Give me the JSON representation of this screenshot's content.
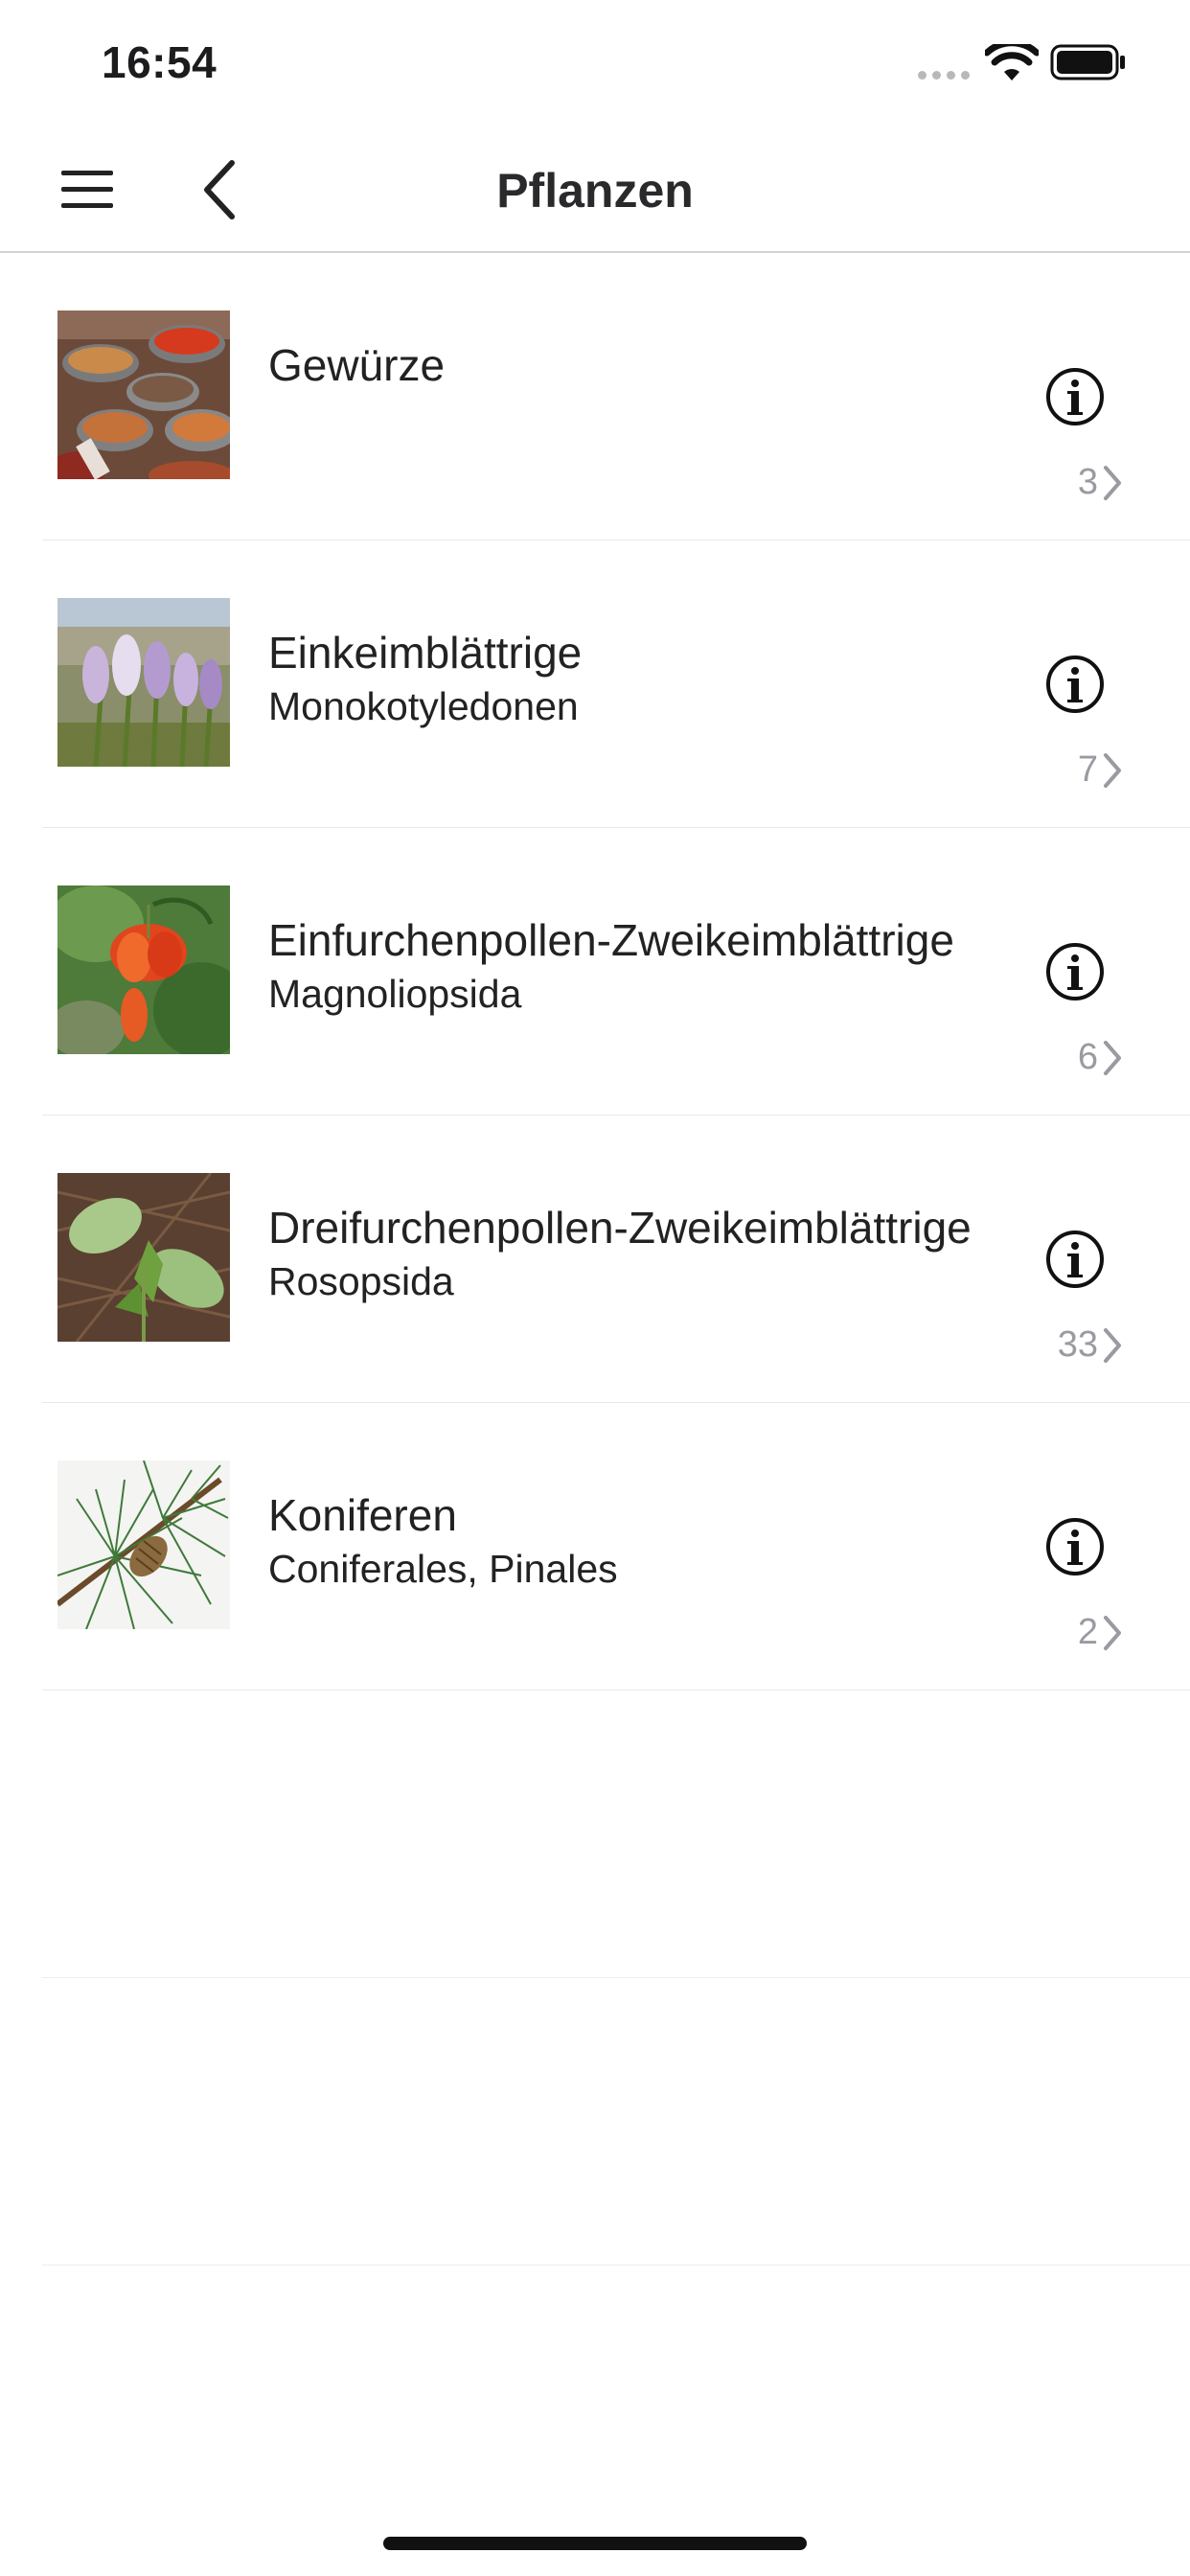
{
  "status_bar": {
    "time": "16:54"
  },
  "nav": {
    "title": "Pflanzen"
  },
  "items": [
    {
      "title": "Gewürze",
      "subtitle": "",
      "count": "3"
    },
    {
      "title": "Einkeimblättrige",
      "subtitle": "Monokotyledonen",
      "count": "7"
    },
    {
      "title": "Einfurchenpollen-Zweikeimblättrige",
      "subtitle": "Magnoliopsida",
      "count": "6"
    },
    {
      "title": "Dreifurchenpollen-Zweikeimblättrige",
      "subtitle": "Rosopsida",
      "count": "33"
    },
    {
      "title": "Koniferen",
      "subtitle": "Coniferales, Pinales",
      "count": "2"
    }
  ]
}
